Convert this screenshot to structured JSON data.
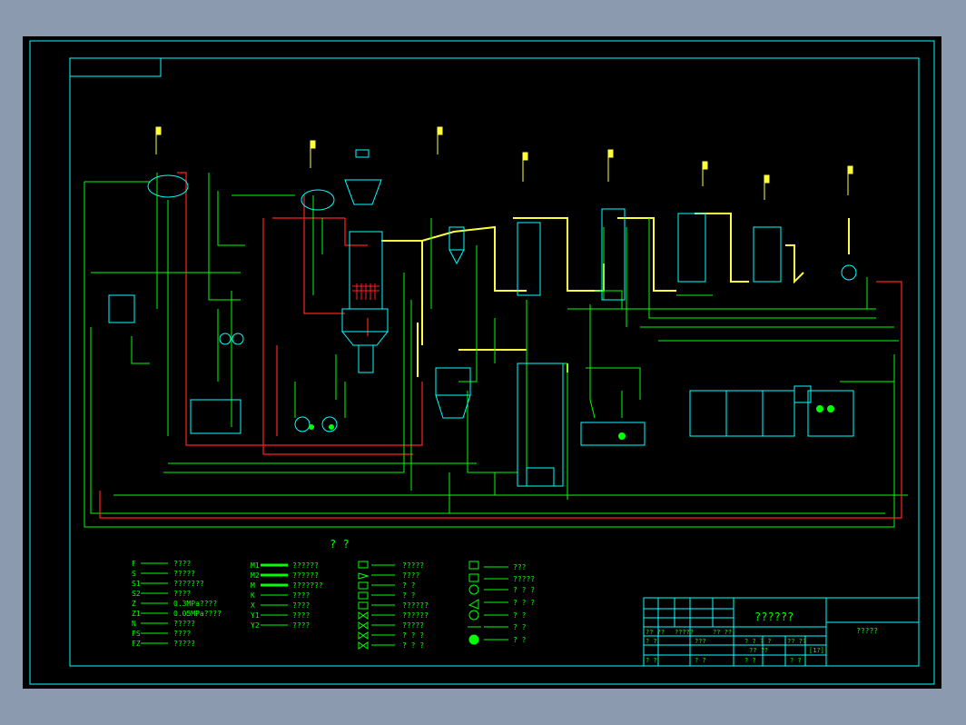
{
  "drawing": {
    "center_title": "? ?",
    "title_block": {
      "drawing_title": "??????",
      "company": "?????",
      "row_labels": [
        "?? ??",
        "?????",
        "?? ??",
        "?? ??",
        "? ?",
        "???",
        "? ? ? ?",
        "?? ??",
        "[1?]",
        "? ?",
        "? ?",
        "? ?",
        "? ?"
      ]
    }
  },
  "legend": {
    "lines": [
      {
        "code": "F",
        "desc": "????"
      },
      {
        "code": "S",
        "desc": "?????"
      },
      {
        "code": "S1",
        "desc": "???????"
      },
      {
        "code": "S2",
        "desc": "????"
      },
      {
        "code": "Z",
        "desc": "0.3MPa????"
      },
      {
        "code": "Z1",
        "desc": "0.05MPa????"
      },
      {
        "code": "N",
        "desc": "?????"
      },
      {
        "code": "FS",
        "desc": "????"
      },
      {
        "code": "FZ",
        "desc": "?????"
      }
    ],
    "materials": [
      {
        "code": "M1",
        "desc": "??????"
      },
      {
        "code": "M2",
        "desc": "??????"
      },
      {
        "code": "M",
        "desc": "???????"
      },
      {
        "code": "K",
        "desc": "????"
      },
      {
        "code": "X",
        "desc": "????"
      },
      {
        "code": "Y1",
        "desc": "????"
      },
      {
        "code": "Y2",
        "desc": "????"
      }
    ],
    "valves": [
      {
        "desc": "?????"
      },
      {
        "desc": "????"
      },
      {
        "desc": "? ?"
      },
      {
        "desc": "? ?"
      },
      {
        "desc": "??????"
      },
      {
        "desc": "??????"
      },
      {
        "desc": "?????"
      },
      {
        "desc": "? ? ?"
      },
      {
        "desc": "? ? ?"
      }
    ],
    "instruments": [
      {
        "desc": "???"
      },
      {
        "desc": "?????"
      },
      {
        "desc": "? ? ?"
      },
      {
        "desc": "? ? ?"
      },
      {
        "desc": "? ?"
      },
      {
        "desc": "? ?"
      },
      {
        "desc": "? ?"
      }
    ]
  },
  "colors": {
    "background": "#000000",
    "frame": "#00ffff",
    "pipe_green": "#00ff00",
    "pipe_red": "#ff2020",
    "pipe_yellow": "#ffff40",
    "equipment": "#00ffff",
    "text": "#00ff00"
  }
}
